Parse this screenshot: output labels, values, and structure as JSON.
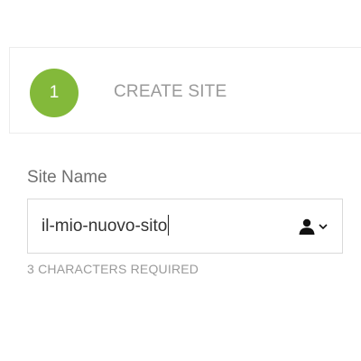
{
  "step": {
    "number": "1",
    "title": "CREATE SITE",
    "circle_color": "#83b93a"
  },
  "site_name": {
    "label": "Site Name",
    "value": "il-mio-nuovo-sito",
    "hint": "3 CHARACTERS REQUIRED",
    "owner_icon": "user-icon",
    "dropdown_icon": "chevron-down-icon"
  }
}
